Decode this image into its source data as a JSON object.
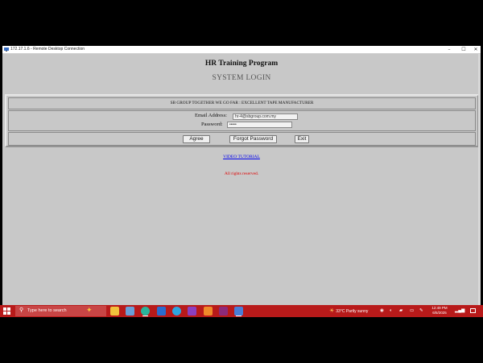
{
  "window": {
    "title": "172.17.1.6 - Remote Desktop Connection",
    "minimize_glyph": "–",
    "maximize_glyph": "☐",
    "close_glyph": "✕"
  },
  "page": {
    "heading": "HR Training Program",
    "subheading": "SYSTEM LOGIN",
    "banner": "SB GROUP TOGETHER WE GO FAR : EXCELLENT TAPE MANUFACTURER",
    "email_label": "Email Address:",
    "email_value": "hr-4@sbgroup.com.my",
    "password_label": "Password:",
    "password_value": "•••••",
    "buttons": {
      "agree": "Agree",
      "forgot": "Forgot Password",
      "exit": "Exit"
    },
    "video_link": "VIDEO TUTORIAL",
    "rights": "All rights reserved."
  },
  "taskbar": {
    "search_placeholder": "Type here to search",
    "apps": [
      "file-explorer",
      "notepad",
      "edge",
      "mail",
      "telegram",
      "onenote",
      "app-orange",
      "winrar",
      "remote-desktop"
    ],
    "weather": {
      "temp": "33°C",
      "desc": "Partly sunny"
    },
    "time": "12:49 PM",
    "date": "6/5/2025"
  },
  "colors": {
    "taskbar": "#b81a1a",
    "page_bg": "#c8c8c8",
    "link": "#0000ee",
    "rights": "#e00000"
  }
}
